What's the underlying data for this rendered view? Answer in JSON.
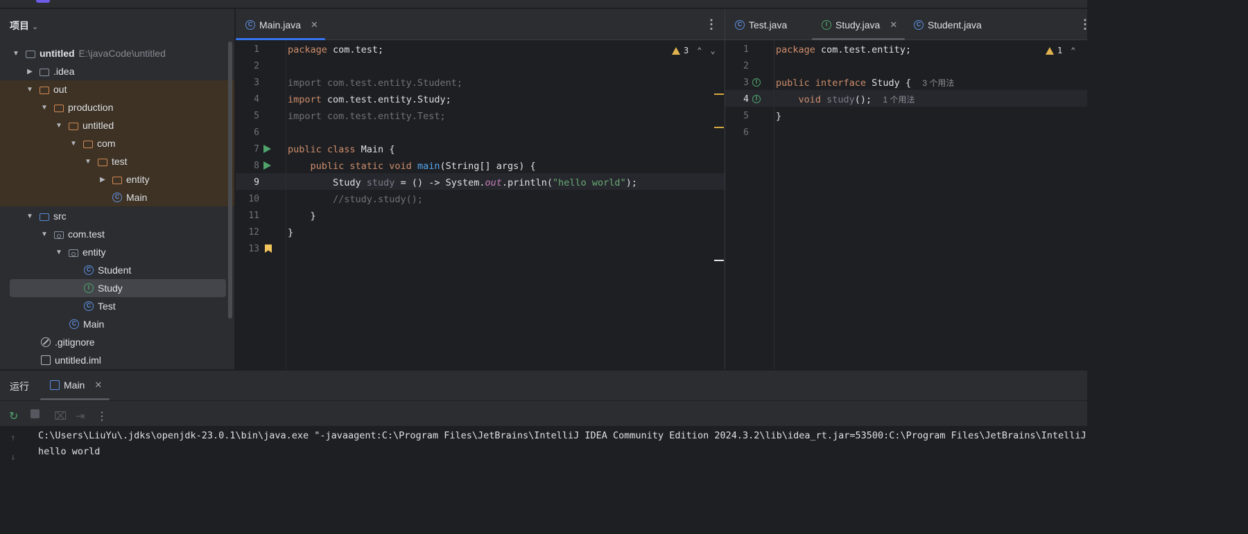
{
  "project": {
    "header": "项目",
    "tree": [
      {
        "label": "untitled",
        "path": "E:\\javaCode\\untitled"
      },
      {
        "label": ".idea"
      },
      {
        "label": "out"
      },
      {
        "label": "production"
      },
      {
        "label": "untitled"
      },
      {
        "label": "com"
      },
      {
        "label": "test"
      },
      {
        "label": "entity"
      },
      {
        "label": "Main"
      },
      {
        "label": "src"
      },
      {
        "label": "com.test"
      },
      {
        "label": "entity"
      },
      {
        "label": "Student"
      },
      {
        "label": "Study"
      },
      {
        "label": "Test"
      },
      {
        "label": "Main"
      },
      {
        "label": ".gitignore"
      },
      {
        "label": "untitled.iml"
      }
    ]
  },
  "editor_left": {
    "tab": "Main.java",
    "warnings": "3",
    "line_numbers": [
      "1",
      "2",
      "3",
      "4",
      "5",
      "6",
      "7",
      "8",
      "9",
      "10",
      "11",
      "12",
      "13"
    ],
    "code": {
      "l1a": "package",
      "l1b": " com.test;",
      "l3": "import com.test.entity.Student;",
      "l4a": "import",
      "l4b": " com.test.entity.Study;",
      "l5": "import com.test.entity.Test;",
      "l7a": "public class",
      "l7b": " Main {",
      "l8a": "    public static void ",
      "l8b": "main",
      "l8c": "(String[] args) {",
      "l9a": "        Study ",
      "l9b": "study",
      "l9c": " = () -> System.",
      "l9d": "out",
      "l9e": ".println(",
      "l9f": "\"hello world\"",
      "l9g": ");",
      "l10": "        //study.study();",
      "l11": "    }",
      "l12": "}"
    }
  },
  "editor_right": {
    "tabs": [
      "Test.java",
      "Study.java",
      "Student.java"
    ],
    "warnings": "1",
    "line_numbers": [
      "1",
      "2",
      "3",
      "4",
      "5",
      "6"
    ],
    "code": {
      "l1a": "package",
      "l1b": " com.test.entity;",
      "l3a": "public interface",
      "l3b": " Study {",
      "l3hint": "3 个用法",
      "l4a": "    void ",
      "l4b": "study",
      "l4c": "();",
      "l4hint": "1 个用法",
      "l5": "}"
    }
  },
  "run_panel": {
    "title": "运行",
    "tab": "Main",
    "console": [
      "C:\\Users\\LiuYu\\.jdks\\openjdk-23.0.1\\bin\\java.exe \"-javaagent:C:\\Program Files\\JetBrains\\IntelliJ IDEA Community Edition 2024.3.2\\lib\\idea_rt.jar=53500:C:\\Program Files\\JetBrains\\IntelliJ",
      "hello world"
    ]
  },
  "colors": {
    "accent": "#3574f0",
    "keyword": "#cf8e6d",
    "string": "#6aab73",
    "function": "#56a8f5",
    "warning": "#e0b34f"
  }
}
